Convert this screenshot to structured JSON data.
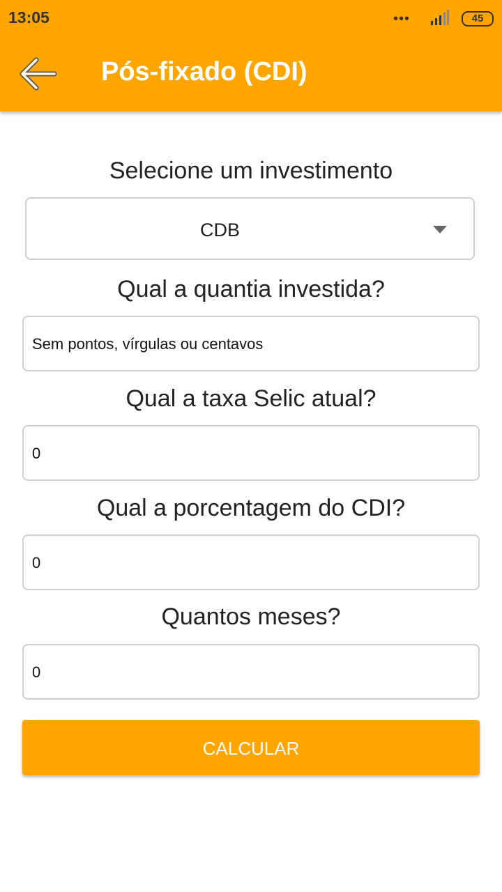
{
  "status": {
    "time": "13:05",
    "dots": "•••",
    "battery": "45"
  },
  "appbar": {
    "title": "Pós-fixado (CDI)",
    "back_icon": "arrow-left-icon"
  },
  "form": {
    "investment_label": "Selecione um investimento",
    "investment_value": "CDB",
    "amount_label": "Qual a quantia investida?",
    "amount_placeholder": "Sem pontos, vírgulas ou centavos",
    "selic_label": "Qual a taxa Selic atual?",
    "selic_value": "0",
    "cdi_label": "Qual a porcentagem do CDI?",
    "cdi_value": "0",
    "months_label": "Quantos meses?",
    "months_value": "0",
    "calculate_label": "CALCULAR"
  },
  "colors": {
    "primary": "#FFA500",
    "text": "#222222",
    "border": "#cfcfcf"
  }
}
